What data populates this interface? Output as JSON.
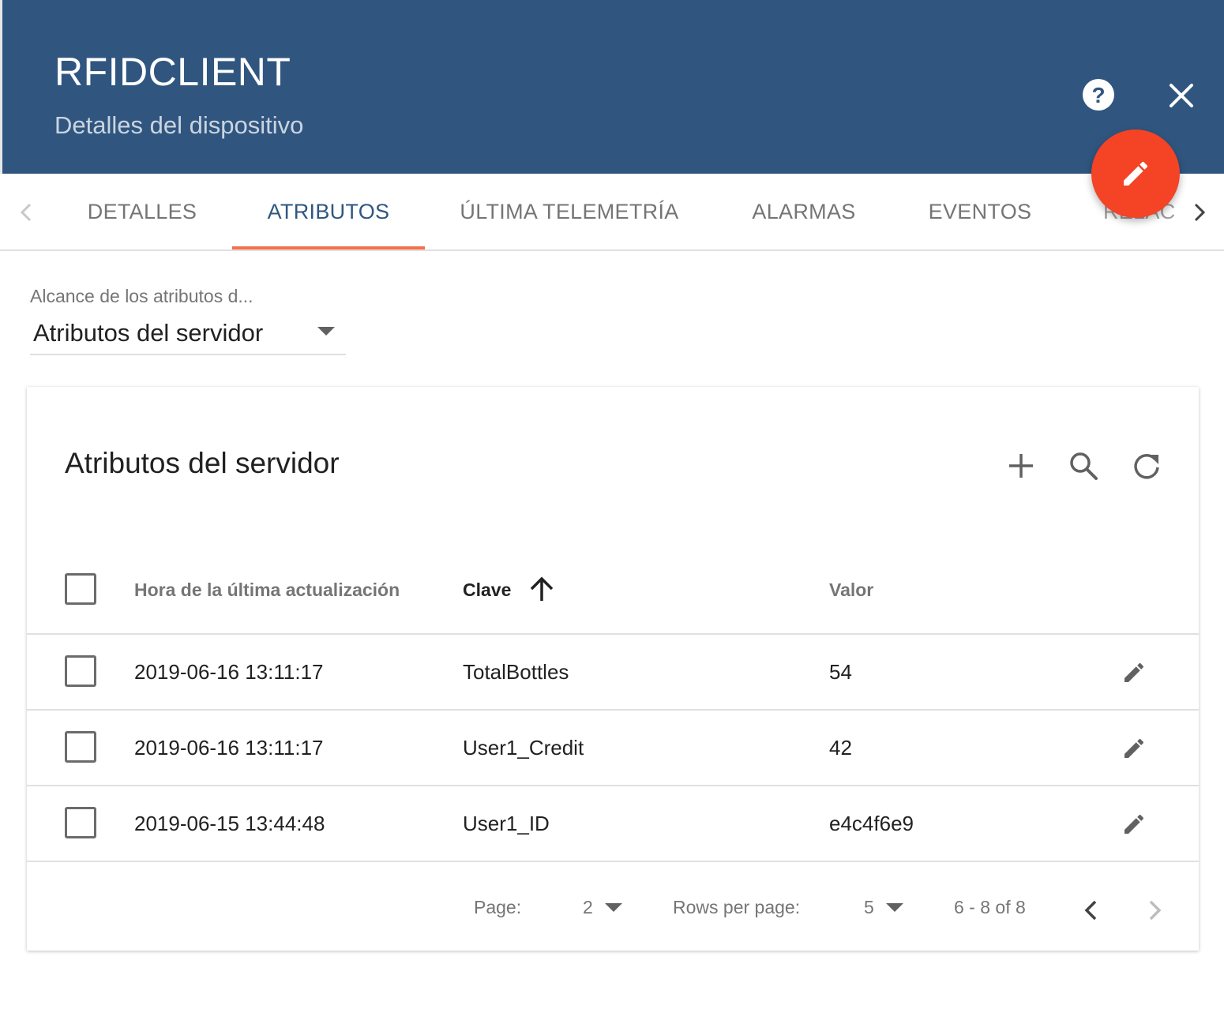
{
  "header": {
    "title": "RFIDCLIENT",
    "subtitle": "Detalles del dispositivo",
    "bg_color": "#305680",
    "help_icon": "help-circle-icon",
    "close_icon": "close-icon",
    "fab_icon": "pencil-icon",
    "fab_color": "#f44325"
  },
  "tabs": {
    "items": [
      {
        "label": "DETALLES"
      },
      {
        "label": "ATRIBUTOS"
      },
      {
        "label": "ÚLTIMA TELEMETRÍA"
      },
      {
        "label": "ALARMAS"
      },
      {
        "label": "EVENTOS"
      },
      {
        "label": "RELACIONES"
      }
    ],
    "active": "ATRIBUTOS",
    "indicator_color": "#f4714d"
  },
  "scope": {
    "label": "Alcance de los atributos d...",
    "value": "Atributos del servidor"
  },
  "card": {
    "title": "Atributos del servidor",
    "columns": {
      "time": "Hora de la última actualización",
      "key": "Clave",
      "value": "Valor"
    },
    "rows": [
      {
        "time": "2019-06-16 13:11:17",
        "key": "TotalBottles",
        "value": "54"
      },
      {
        "time": "2019-06-16 13:11:17",
        "key": "User1_Credit",
        "value": "42"
      },
      {
        "time": "2019-06-15 13:44:48",
        "key": "User1_ID",
        "value": "e4c4f6e9"
      }
    ],
    "footer": {
      "page_label": "Page:",
      "page_value": "2",
      "rows_label": "Rows per page:",
      "rows_value": "5",
      "range": "6 - 8 of 8"
    }
  }
}
